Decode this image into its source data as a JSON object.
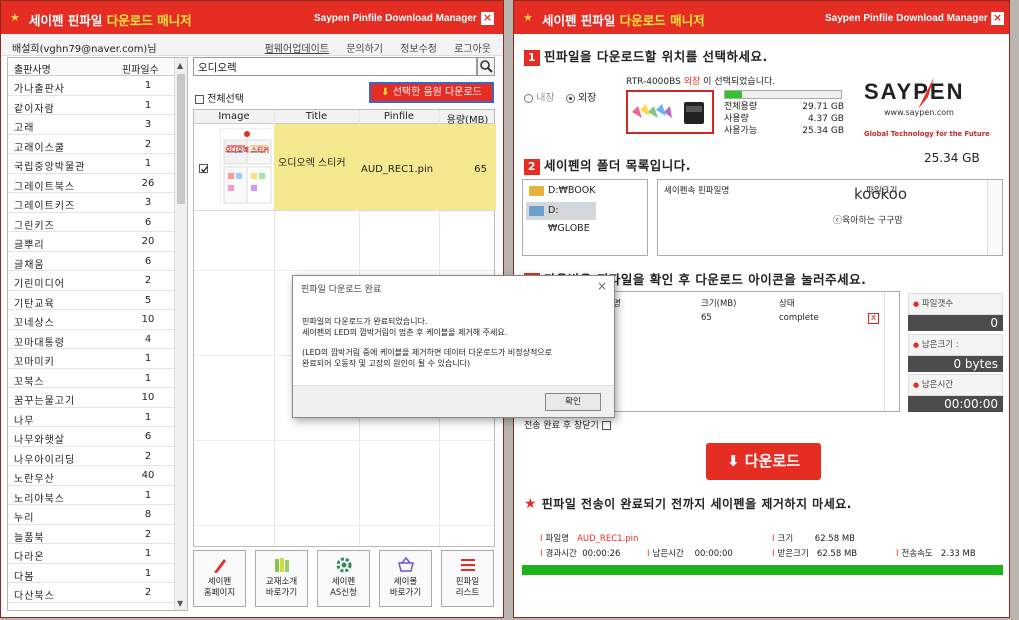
{
  "left_window": {
    "title_white": "세이펜 핀파일 ",
    "title_yellow": "다운로드 매니저",
    "title_en": "Saypen Pinfile Download Manager",
    "close": "×",
    "user": "배설희(vghn79@naver.com)님",
    "links": [
      "펌웨어업데이트",
      "문의하기",
      "정보수정",
      "로그아웃"
    ],
    "publisher_header": {
      "name": "출판사명",
      "count": "핀파일수"
    },
    "publishers": [
      {
        "name": "가나출판사",
        "count": "1"
      },
      {
        "name": "같이자람",
        "count": "1"
      },
      {
        "name": "고래",
        "count": "3"
      },
      {
        "name": "고래이스쿨",
        "count": "2"
      },
      {
        "name": "국립중앙박물관",
        "count": "1"
      },
      {
        "name": "그레이트북스",
        "count": "26"
      },
      {
        "name": "그레이트키즈",
        "count": "3"
      },
      {
        "name": "그린키즈",
        "count": "6"
      },
      {
        "name": "글뿌리",
        "count": "20"
      },
      {
        "name": "글채움",
        "count": "6"
      },
      {
        "name": "기린미디어",
        "count": "2"
      },
      {
        "name": "기탄교육",
        "count": "5"
      },
      {
        "name": "꼬네상스",
        "count": "10"
      },
      {
        "name": "꼬마대통령",
        "count": "4"
      },
      {
        "name": "꼬마미키",
        "count": "1"
      },
      {
        "name": "꼬북스",
        "count": "1"
      },
      {
        "name": "꿈꾸는물고기",
        "count": "10"
      },
      {
        "name": "나무",
        "count": "1"
      },
      {
        "name": "나무와햇살",
        "count": "6"
      },
      {
        "name": "나우아이리딩",
        "count": "2"
      },
      {
        "name": "노란우산",
        "count": "40"
      },
      {
        "name": "노리야북스",
        "count": "1"
      },
      {
        "name": "누리",
        "count": "8"
      },
      {
        "name": "늘품북",
        "count": "2"
      },
      {
        "name": "다라온",
        "count": "1"
      },
      {
        "name": "다봄",
        "count": "1"
      },
      {
        "name": "다산북스",
        "count": "2"
      }
    ],
    "search_value": "오디오렉",
    "select_all": "전체선택",
    "download_selected": "선택한 음원 다운로드",
    "grid_headers": {
      "image": "Image",
      "title": "Title",
      "pinfile": "Pinfile",
      "size": "용량(MB)"
    },
    "grid_row": {
      "title": "오디오렉 스티커",
      "pinfile": "AUD_REC1.pin",
      "size": "65",
      "thumb_caption": "오디오렉 스티커"
    },
    "tools": [
      {
        "icon": "pen-icon",
        "label1": "세이펜",
        "label2": "홈페이지"
      },
      {
        "icon": "books-icon",
        "label1": "교재소개",
        "label2": "바로가기"
      },
      {
        "icon": "gear-icon",
        "label1": "세이펜",
        "label2": "AS신청"
      },
      {
        "icon": "basket-icon",
        "label1": "세이몰",
        "label2": "바로가기"
      },
      {
        "icon": "list-icon",
        "label1": "핀파일",
        "label2": "리스트"
      }
    ]
  },
  "dialog": {
    "title": "핀파일 다운로드 완료",
    "close": "×",
    "lines": [
      "핀파일의 다운로드가 완료되었습니다.",
      "세이펜의 LED의 깜박거림이 멈춘 후 케이블을 제거해 주세요.",
      "",
      "(LED의 깜박거림 중에 케이블을 제거하면 데이터 다운로드가 비정상적으로",
      "완료되어 오동작 및 고장의 원인이 될 수 있습니다)"
    ],
    "ok": "확인"
  },
  "right_window": {
    "title_white": "세이펜 핀파일 ",
    "title_yellow": "다운로드 매니저",
    "title_en": "Saypen Pinfile Download Manager",
    "close": "×",
    "step1": {
      "num": "1",
      "text": "핀파일을 다운로드할 위치를 선택하세요."
    },
    "radio_internal": "내장",
    "radio_external": "외장",
    "device_prefix": "RTR-4000BS ",
    "device_highlight": "외장",
    "device_suffix": "이 선택되었습니다.",
    "storage": [
      {
        "label": "전체용량",
        "value": "29.71 GB"
      },
      {
        "label": "사용량",
        "value": "4.37 GB"
      },
      {
        "label": "사용가능",
        "value": "25.34 GB"
      }
    ],
    "usage_fraction": 0.147,
    "brand": "SAYPEN",
    "brand_url": "www.saypen.com",
    "brand_tagline": "Global Technology for the Future",
    "free_space": "25.34 GB",
    "step2": {
      "num": "2",
      "text": "세이펜의 폴더 목록입니다."
    },
    "folders": [
      "D:₩BOOK",
      "D:₩GLOBE"
    ],
    "pin_headers": {
      "name": "세이펜속 핀파일명",
      "size": "파일크기"
    },
    "watermark": "kookoo",
    "watermark_sub": "ⓒ육아하는 구구맘",
    "step3": {
      "num": "3",
      "text": "다운받을 핀파일을 확인 후 다운로드 아이콘을 눌러주세요."
    },
    "dl_headers": {
      "name": "명",
      "size": "크기(MB)",
      "status": "상태"
    },
    "dl_row": {
      "size": "65",
      "status": "complete",
      "delete": "x"
    },
    "stats": [
      {
        "label": "파일갯수",
        "value": "0"
      },
      {
        "label": "남은크기 :",
        "value": "0 bytes"
      },
      {
        "label": "남은시간",
        "value": "00:00:00"
      }
    ],
    "close_after": "전송 완료 후 창닫기",
    "download_button": "다운로드",
    "warning": "핀파일 전송이 완료되기 전까지 세이펜을 제거하지 마세요.",
    "info": {
      "pinfile_label": "파일명",
      "pinfile_value": "AUD_REC1.pin",
      "size_label": "크기",
      "size_value": "62.58 MB",
      "elapsed_label": "경과시간",
      "elapsed_value": "00:00:26",
      "remain_label": "남은시간",
      "remain_value": "00:00:00",
      "received_label": "받은크기",
      "received_value": "62.58 MB",
      "speed_label": "전송속도",
      "speed_value": "2.33 MB"
    },
    "colors": {
      "brand_red": "#e52d24",
      "progress_green": "#1db31b",
      "highlight_yellow": "#f5e98f"
    }
  }
}
